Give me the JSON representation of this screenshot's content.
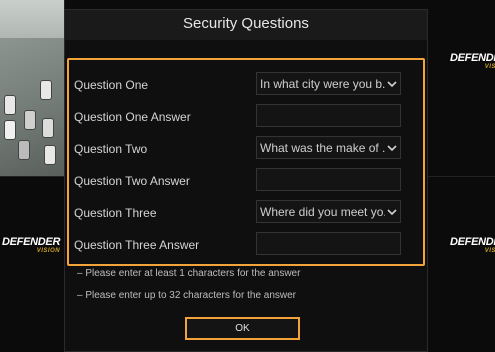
{
  "background": {
    "logo_text": "DEFENDER",
    "logo_sub": "VISION",
    "top_label": " "
  },
  "dialog": {
    "title": "Security Questions",
    "rows": [
      {
        "label": "Question One",
        "kind": "select",
        "value": "In what city were you b..."
      },
      {
        "label": "Question One Answer",
        "kind": "input",
        "value": ""
      },
      {
        "label": "Question Two",
        "kind": "select",
        "value": "What was the make of ..."
      },
      {
        "label": "Question Two Answer",
        "kind": "input",
        "value": ""
      },
      {
        "label": "Question Three",
        "kind": "select",
        "value": "Where did you meet yo..."
      },
      {
        "label": "Question Three Answer",
        "kind": "input",
        "value": ""
      }
    ],
    "hints": [
      "– Please enter at least 1 characters for the answer",
      "– Please enter up to 32 characters for the answer"
    ],
    "ok_label": "OK"
  },
  "colors": {
    "accent": "#f2a33a",
    "background": "#0f0f0f"
  }
}
